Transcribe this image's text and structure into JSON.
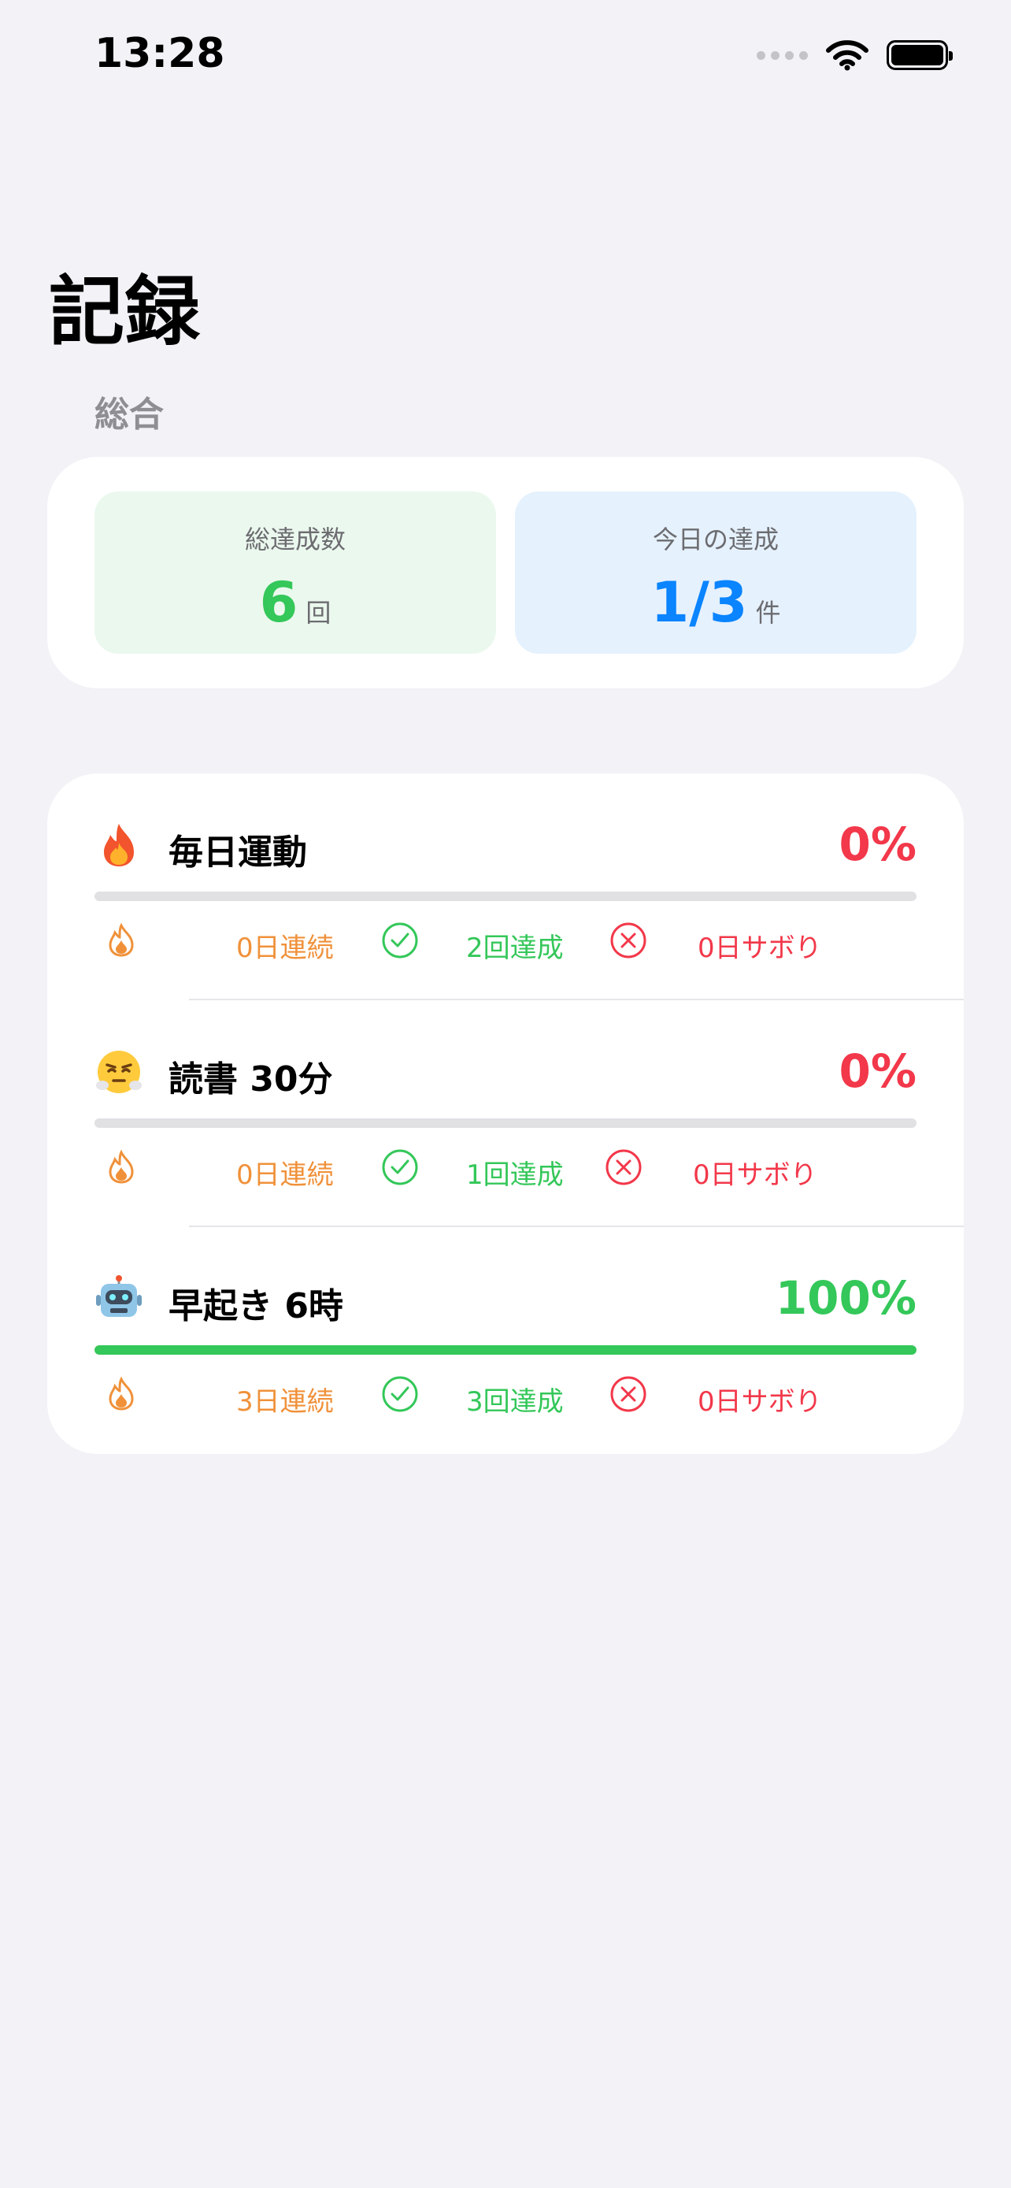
{
  "status_bar": {
    "time": "13:28"
  },
  "page": {
    "title": "記録",
    "section_label": "総合"
  },
  "summary": {
    "total": {
      "label": "総達成数",
      "value": "6",
      "unit": "回"
    },
    "today": {
      "label": "今日の達成",
      "value": "1/3",
      "unit": "件"
    }
  },
  "habits": [
    {
      "emoji": "fire",
      "name": "毎日運動",
      "percent_label": "0%",
      "progress": 0,
      "streak": "0日連続",
      "achieved": "2回達成",
      "skipped": "0日サボり"
    },
    {
      "emoji": "steam-face",
      "name": "読書 30分",
      "percent_label": "0%",
      "progress": 0,
      "streak": "0日連続",
      "achieved": "1回達成",
      "skipped": "0日サボり"
    },
    {
      "emoji": "robot",
      "name": "早起き 6時",
      "percent_label": "100%",
      "progress": 100,
      "streak": "3日連続",
      "achieved": "3回達成",
      "skipped": "0日サボり"
    }
  ],
  "colors": {
    "accent_green": "#34C759",
    "accent_blue": "#0A84FF",
    "accent_red": "#F2384A",
    "accent_orange": "#F0913A"
  }
}
